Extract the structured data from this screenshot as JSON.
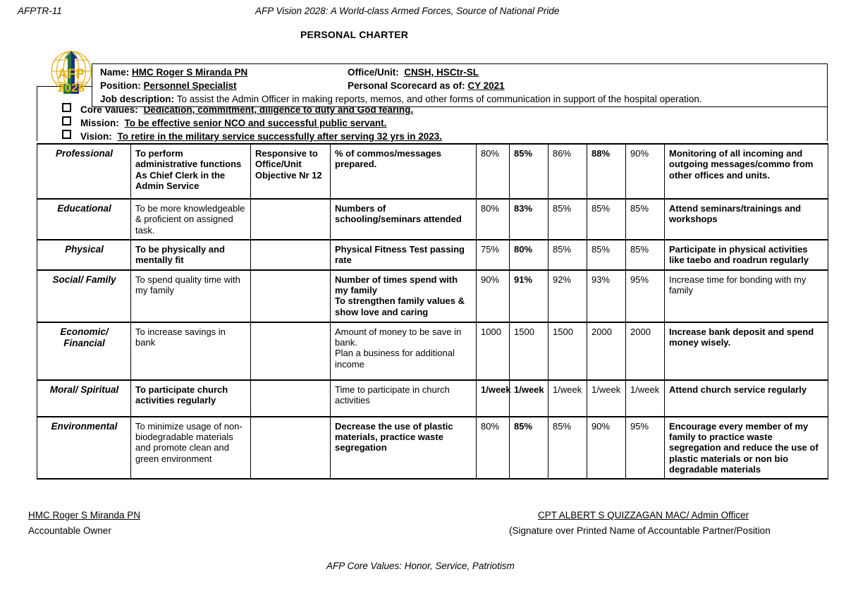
{
  "page_header": {
    "form_code": "AFPTR-11",
    "vision_statement": "AFP Vision 2028: A World-class Armed Forces, Source of National Pride"
  },
  "logo": {
    "name": "afp-2028-emblem",
    "text_top": "AFP",
    "text_bottom": "2028",
    "colors": {
      "globe": "#d8a800",
      "arrow_green": "#1f7a3d",
      "arrow_blue": "#1b2f8a",
      "text_gold": "#e8b400"
    }
  },
  "identity": {
    "name_label": "Name:",
    "name_value": "HMC Roger S Miranda PN",
    "position_label": "Position:",
    "position_value": "Personnel Specialist",
    "job_label": "Job description:",
    "job_value": "To assist the Admin Officer in making reports,  memos,  and other forms of communication in support of the hospital operation.",
    "office_label": "Office/Unit:",
    "office_value": "CNSH, HSCtr-SL",
    "scorecard_label": "Personal Scorecard as of:",
    "scorecard_value": "CY 2021",
    "overlap_title": "PERSONAL CHARTER"
  },
  "bullets": [
    {
      "label": "Core Values:",
      "value": "Dedication, commitment,  diligence to duty and God fearing."
    },
    {
      "label": "Mission:",
      "value": "To be effective senior NCO and successful public servant."
    },
    {
      "label": "Vision:",
      "value": "To retire in the military service successfully after serving 32 yrs in 2023."
    }
  ],
  "scorecard": {
    "rows": [
      {
        "area": "Professional",
        "objective": [
          "To perform administrative functions",
          "As Chief Clerk in the Admin Service"
        ],
        "link": [
          "Responsive to Office/Unit Objective Nr 12"
        ],
        "indicator": [
          "% of commos/messages prepared."
        ],
        "targets": [
          "80%",
          "85%",
          "86%",
          "88%",
          "90%"
        ],
        "remarks": [
          "Monitoring of all incoming and outgoing messages/commo from other offices and units."
        ]
      },
      {
        "area": "Educational",
        "objective": [
          "To be more knowledgeable & proficient on assigned task."
        ],
        "link": [
          ""
        ],
        "indicator": [
          "Numbers of schooling/seminars attended"
        ],
        "targets": [
          "80%",
          "83%",
          "85%",
          "85%",
          "85%"
        ],
        "remarks": [
          "Attend seminars/trainings and workshops"
        ]
      },
      {
        "area": "Physical",
        "objective": [
          "To be physically and mentally fit"
        ],
        "link": [
          ""
        ],
        "indicator": [
          "Physical Fitness Test passing rate"
        ],
        "targets": [
          "75%",
          "80%",
          "85%",
          "85%",
          "85%"
        ],
        "remarks": [
          "Participate in physical activities like taebo and roadrun regularly"
        ]
      },
      {
        "area": "Social/ Family",
        "objective": [
          "To spend quality time with my family"
        ],
        "link": [
          ""
        ],
        "indicator": [
          "Number of times spend with my family",
          "To strengthen family values & show love and caring"
        ],
        "targets": [
          "90%",
          "91%",
          "92%",
          "93%",
          "95%"
        ],
        "remarks": [
          "Increase time for bonding with my family"
        ]
      },
      {
        "area": "Economic/ Financial",
        "objective": [
          "To increase savings in bank"
        ],
        "link": [
          ""
        ],
        "indicator": [
          "Amount of money to be save in bank.",
          "Plan a business for additional income"
        ],
        "targets": [
          "1000",
          "1500",
          "1500",
          "2000",
          "2000"
        ],
        "remarks": [
          "Increase bank deposit and spend money wisely."
        ]
      },
      {
        "area": "Moral/ Spiritual",
        "objective": [
          "To participate  church activities regularly"
        ],
        "link": [
          ""
        ],
        "indicator": [
          "Time to participate in church activities"
        ],
        "targets": [
          "1/week",
          "1/week",
          "1/week",
          "1/week",
          "1/week"
        ],
        "remarks": [
          "Attend church service regularly"
        ]
      },
      {
        "area": "Environmental",
        "objective": [
          "To minimize usage of non-biodegradable materials and promote clean and green environment"
        ],
        "link": [
          ""
        ],
        "indicator": [
          "Decrease the use of plastic materials, practice waste segregation"
        ],
        "targets": [
          "80%",
          "85%",
          "85%",
          "90%",
          "95%"
        ],
        "remarks": [
          "Encourage every member of my family to practice waste segregation and reduce the use of plastic materials or non bio degradable materials"
        ]
      }
    ]
  },
  "signatures": {
    "owner_name": "HMC Roger S Miranda PN",
    "owner_role": "Accountable Owner",
    "partner_name": "CPT ALBERT S QUIZZAGAN MAC/ Admin Officer",
    "partner_role": "(Signature over Printed Name of Accountable Partner/Position"
  },
  "footer": {
    "core_values": "AFP Core Values: Honor, Service, Patriotism"
  }
}
